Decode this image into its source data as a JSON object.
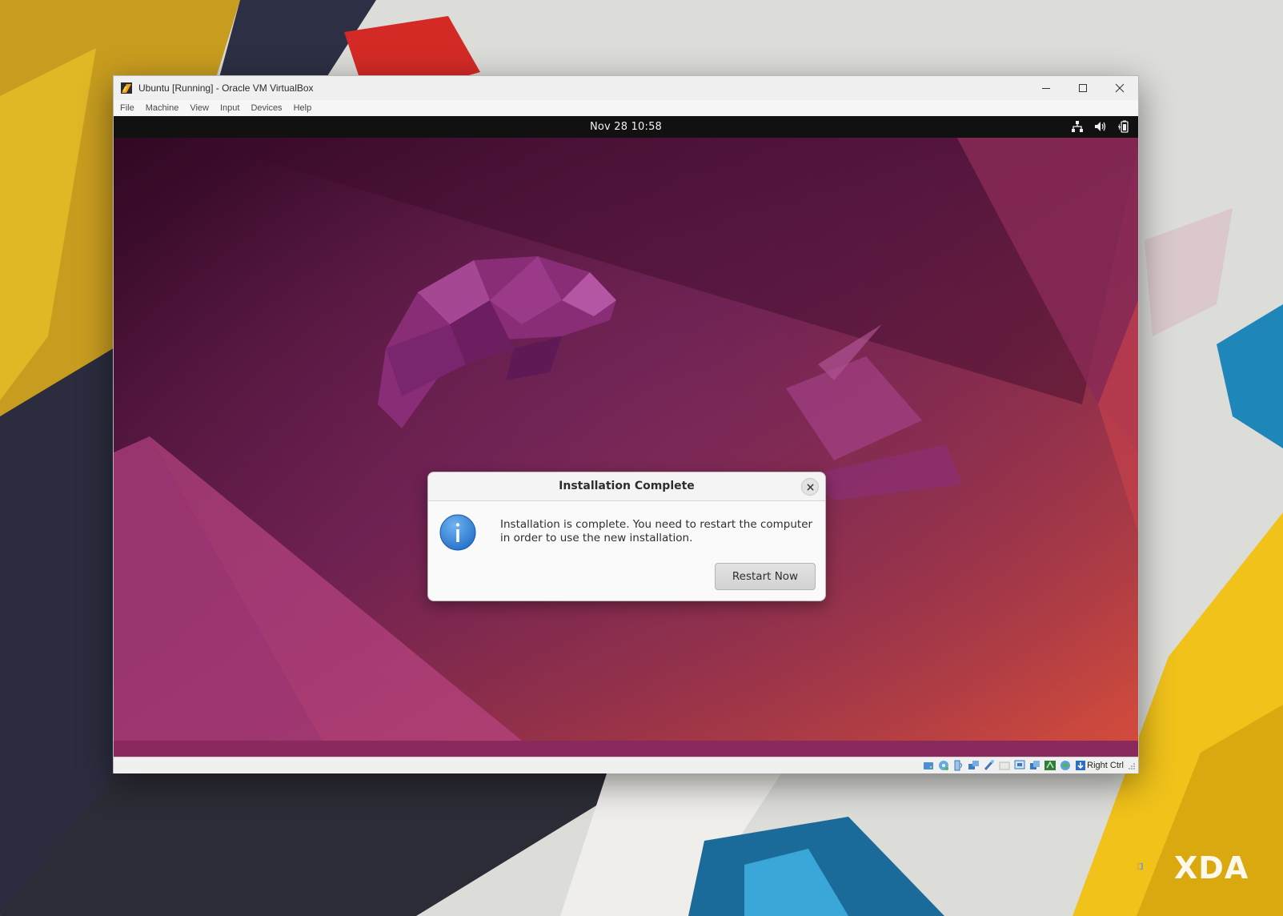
{
  "window": {
    "title": "Ubuntu [Running] - Oracle VM VirtualBox",
    "menu": [
      "File",
      "Machine",
      "View",
      "Input",
      "Devices",
      "Help"
    ]
  },
  "guest": {
    "clock": "Nov 28  10:58",
    "tray_icons": [
      "network-icon",
      "volume-icon",
      "battery-icon"
    ]
  },
  "dialog": {
    "title": "Installation Complete",
    "message": "Installation is complete. You need to restart the computer in order to use the new installation.",
    "button_label": "Restart Now"
  },
  "statusbar": {
    "host_key": "Right Ctrl",
    "icons": [
      "hard-disk-icon",
      "optical-drive-icon",
      "audio-icon",
      "network-adapters-icon",
      "usb-icon",
      "shared-folders-icon",
      "display-icon",
      "video-capture-icon",
      "vm-window-icon",
      "cpu-icon",
      "mouse-integration-icon",
      "guest-additions-icon",
      "keyboard-capture-icon"
    ]
  },
  "watermark": {
    "text": "XDA"
  },
  "colors": {
    "accent_info": "#2f7fd6",
    "wallpaper_dark": "#3a0a2b",
    "wallpaper_mid": "#7a2459",
    "wallpaper_warm": "#c8414a"
  }
}
